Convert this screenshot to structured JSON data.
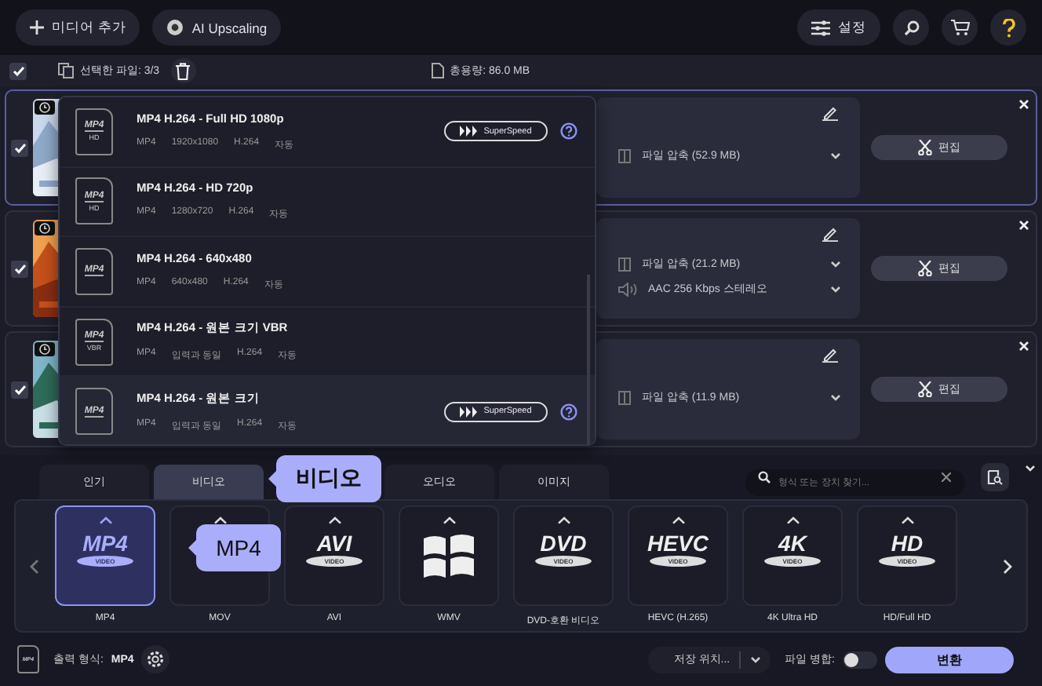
{
  "toolbar": {
    "add_media": "미디어 추가",
    "ai_upscaling": "AI Upscaling",
    "settings": "설정"
  },
  "selection_bar": {
    "checked": true,
    "selected_files": "선택한 파일: 3/3",
    "total_size": "총용량: 86.0 MB"
  },
  "files": [
    {
      "checked": true,
      "highlighted": true,
      "compression": "파일 압축 (52.9 MB)",
      "edit": "편집"
    },
    {
      "checked": true,
      "highlighted": false,
      "compression": "파일 압축 (21.2 MB)",
      "audio": "AAC 256 Kbps 스테레오",
      "edit": "편집"
    },
    {
      "checked": true,
      "highlighted": false,
      "compression": "파일 압축 (11.9 MB)",
      "edit": "편집"
    }
  ],
  "preset_menu": {
    "items": [
      {
        "badge": "MP4",
        "badge_sub": "HD",
        "title": "MP4 H.264 - Full HD 1080p",
        "specs": [
          "MP4",
          "1920x1080",
          "H.264",
          "자동"
        ],
        "superspeed": "SuperSpeed",
        "selected": false
      },
      {
        "badge": "MP4",
        "badge_sub": "HD",
        "title": "MP4 H.264 - HD 720p",
        "specs": [
          "MP4",
          "1280x720",
          "H.264",
          "자동"
        ],
        "selected": false
      },
      {
        "badge": "MP4",
        "title": "MP4 H.264 - 640x480",
        "specs": [
          "MP4",
          "640x480",
          "H.264",
          "자동"
        ],
        "selected": false
      },
      {
        "badge": "MP4",
        "badge_sub": "VBR",
        "title": "MP4 H.264 - 원본 크기 VBR",
        "specs": [
          "MP4",
          "입력과 동일",
          "H.264",
          "자동"
        ],
        "selected": false
      },
      {
        "badge": "MP4",
        "title": "MP4 H.264 - 원본 크기",
        "specs": [
          "MP4",
          "입력과 동일",
          "H.264",
          "자동"
        ],
        "superspeed": "SuperSpeed",
        "selected": true
      }
    ]
  },
  "format_tabs": [
    {
      "label": "인기",
      "selected": false
    },
    {
      "label": "비디오",
      "selected": true
    },
    {
      "label": "오디오",
      "selected": false
    },
    {
      "label": "이미지",
      "selected": false
    }
  ],
  "tab_tooltip": "비디오",
  "format_search": {
    "placeholder": "형식 또는 장치 찾기..."
  },
  "formats": [
    {
      "kind": "logo",
      "logo": "MP4",
      "disc": "VIDEO",
      "label": "MP4",
      "selected": true
    },
    {
      "kind": "covered",
      "label": "MOV",
      "selected": false
    },
    {
      "kind": "logo",
      "logo": "AVI",
      "disc": "VIDEO",
      "label": "AVI",
      "selected": false
    },
    {
      "kind": "windows",
      "label": "WMV",
      "selected": false
    },
    {
      "kind": "logo",
      "logo": "DVD",
      "disc": "VIDEO",
      "label": "DVD-호환 비디오",
      "selected": false
    },
    {
      "kind": "logo",
      "logo": "HEVC",
      "disc": "VIDEO",
      "label": "HEVC (H.265)",
      "selected": false
    },
    {
      "kind": "logo",
      "logo": "4K",
      "disc": "VIDEO",
      "label": "4K Ultra HD",
      "selected": false
    },
    {
      "kind": "logo",
      "logo": "HD",
      "disc": "VIDEO",
      "label": "HD/Full HD",
      "selected": false
    }
  ],
  "format_tooltip": "MP4",
  "footer": {
    "output_badge": "MP4",
    "output_label": "출력 형식:",
    "output_value": "MP4",
    "save_location": "저장 위치...",
    "merge_label": "파일 병합:",
    "merge_on": false,
    "convert": "변환"
  }
}
